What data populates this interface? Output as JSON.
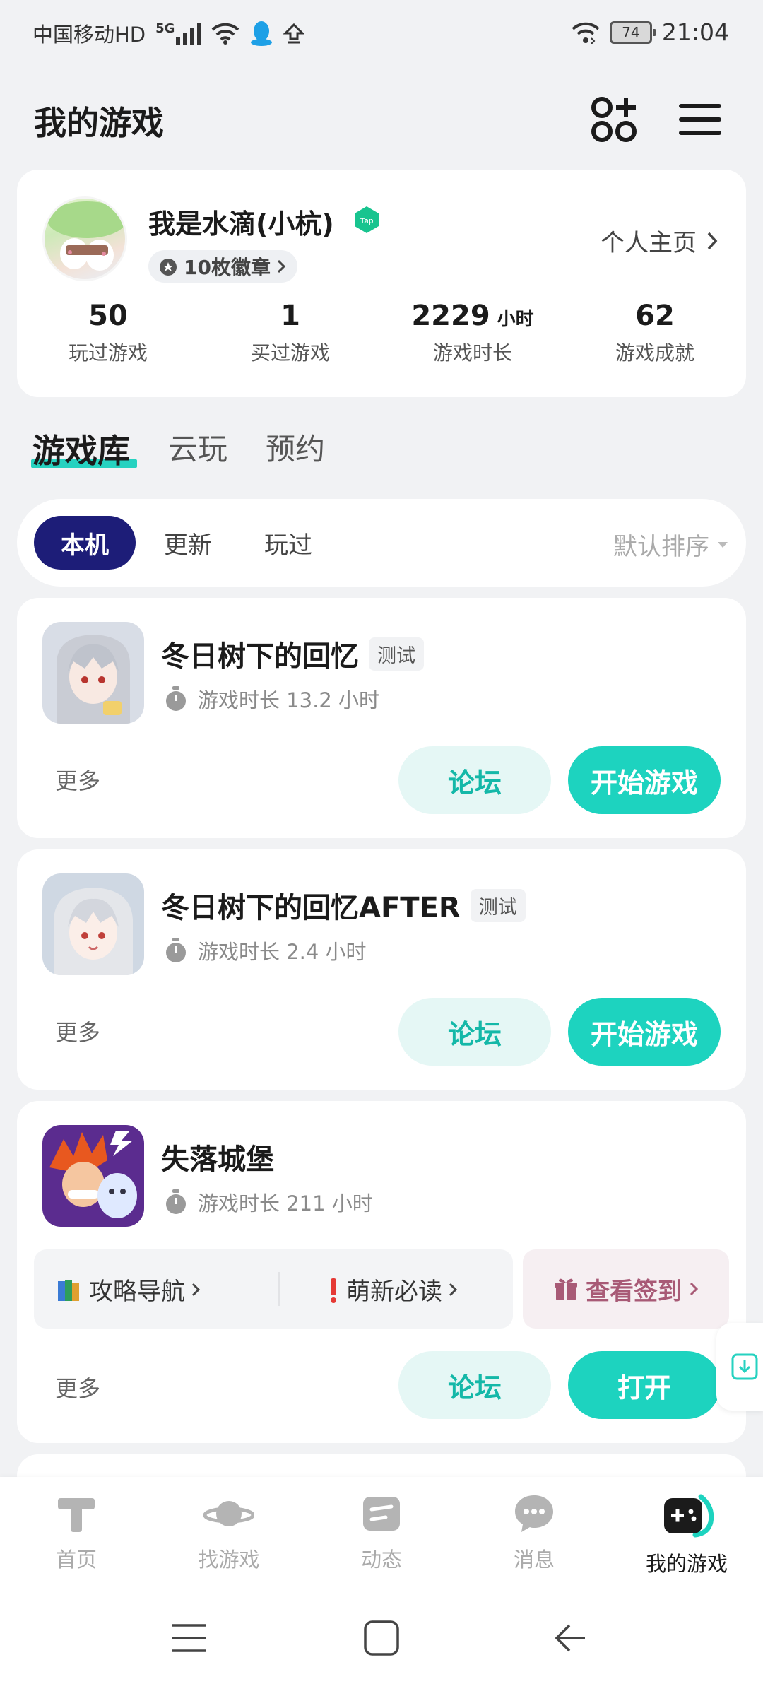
{
  "status_bar": {
    "carrier": "中国移动HD",
    "network": "5G",
    "battery": "74",
    "time": "21:04",
    "icons": [
      "signal-icon",
      "wifi-icon",
      "qq-icon",
      "upload-icon",
      "wifi-call-icon",
      "battery-icon"
    ]
  },
  "header": {
    "title": "我的游戏",
    "icons": [
      "apps-grid-icon",
      "menu-icon"
    ]
  },
  "profile": {
    "name": "我是水滴(小杭)",
    "badge_text": "10枚徽章",
    "home_link": "个人主页",
    "stats": [
      {
        "value": "50",
        "unit": "",
        "label": "玩过游戏"
      },
      {
        "value": "1",
        "unit": "",
        "label": "买过游戏"
      },
      {
        "value": "2229",
        "unit": "小时",
        "label": "游戏时长"
      },
      {
        "value": "62",
        "unit": "",
        "label": "游戏成就"
      }
    ]
  },
  "tabs": {
    "items": [
      "游戏库",
      "云玩",
      "预约"
    ],
    "active": "游戏库"
  },
  "filters": {
    "items": [
      "本机",
      "更新",
      "玩过"
    ],
    "active": "本机",
    "sort_label": "默认排序"
  },
  "games": [
    {
      "name": "冬日树下的回忆",
      "tag": "测试",
      "playtime": "游戏时长 13.2 小时",
      "more": "更多",
      "forum": "论坛",
      "action": "开始游戏"
    },
    {
      "name": "冬日树下的回忆AFTER",
      "tag": "测试",
      "playtime": "游戏时长 2.4 小时",
      "more": "更多",
      "forum": "论坛",
      "action": "开始游戏"
    },
    {
      "name": "失落城堡",
      "tag": "",
      "playtime": "游戏时长 211 小时",
      "more": "更多",
      "forum": "论坛",
      "action": "打开",
      "links": {
        "guide": "攻略导航",
        "newbie": "萌新必读",
        "signin": "查看签到"
      }
    }
  ],
  "bottom_nav": {
    "items": [
      {
        "label": "首页",
        "icon": "tap-home-icon"
      },
      {
        "label": "找游戏",
        "icon": "planet-icon"
      },
      {
        "label": "动态",
        "icon": "feed-icon"
      },
      {
        "label": "消息",
        "icon": "chat-bubble-icon"
      },
      {
        "label": "我的游戏",
        "icon": "gamepad-icon"
      }
    ],
    "active": "我的游戏"
  },
  "colors": {
    "accent": "#1dd3bf",
    "accent_light": "#e5f7f5",
    "filter_active": "#1d1d78",
    "background": "#f1f2f4"
  }
}
